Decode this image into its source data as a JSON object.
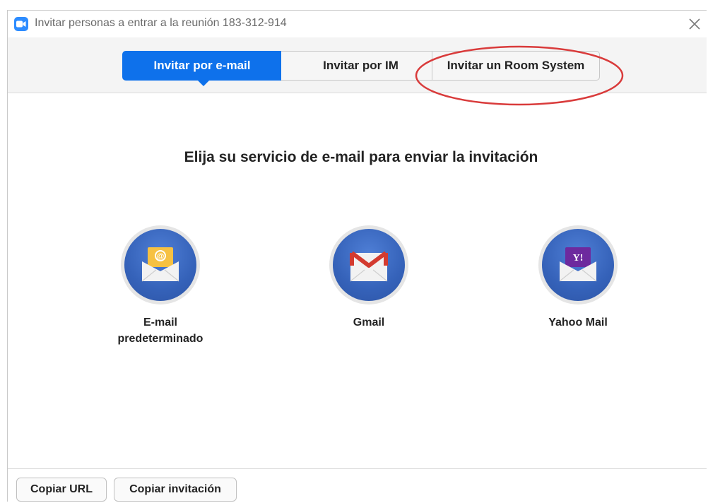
{
  "window": {
    "title": "Invitar personas a entrar a la reunión 183-312-914",
    "app_icon": "zoom-camera-icon",
    "close_icon": "close-icon"
  },
  "tabs": [
    {
      "label": "Invitar por e-mail",
      "active": true
    },
    {
      "label": "Invitar por IM",
      "active": false
    },
    {
      "label": "Invitar un Room System",
      "active": false,
      "highlighted": true
    }
  ],
  "main": {
    "heading": "Elija su servicio de e-mail para enviar la invitación",
    "services": [
      {
        "label_line1": "E-mail",
        "label_line2": "predeterminado",
        "icon": "default-email-envelope-icon"
      },
      {
        "label_line1": "Gmail",
        "icon": "gmail-envelope-icon"
      },
      {
        "label_line1": "Yahoo Mail",
        "icon": "yahoo-envelope-icon"
      }
    ]
  },
  "footer": {
    "copy_url_label": "Copiar URL",
    "copy_invitation_label": "Copiar invitación"
  },
  "colors": {
    "accent": "#0e71eb",
    "highlight_annotation": "#d93b3b",
    "service_circle": "#3562b9"
  }
}
